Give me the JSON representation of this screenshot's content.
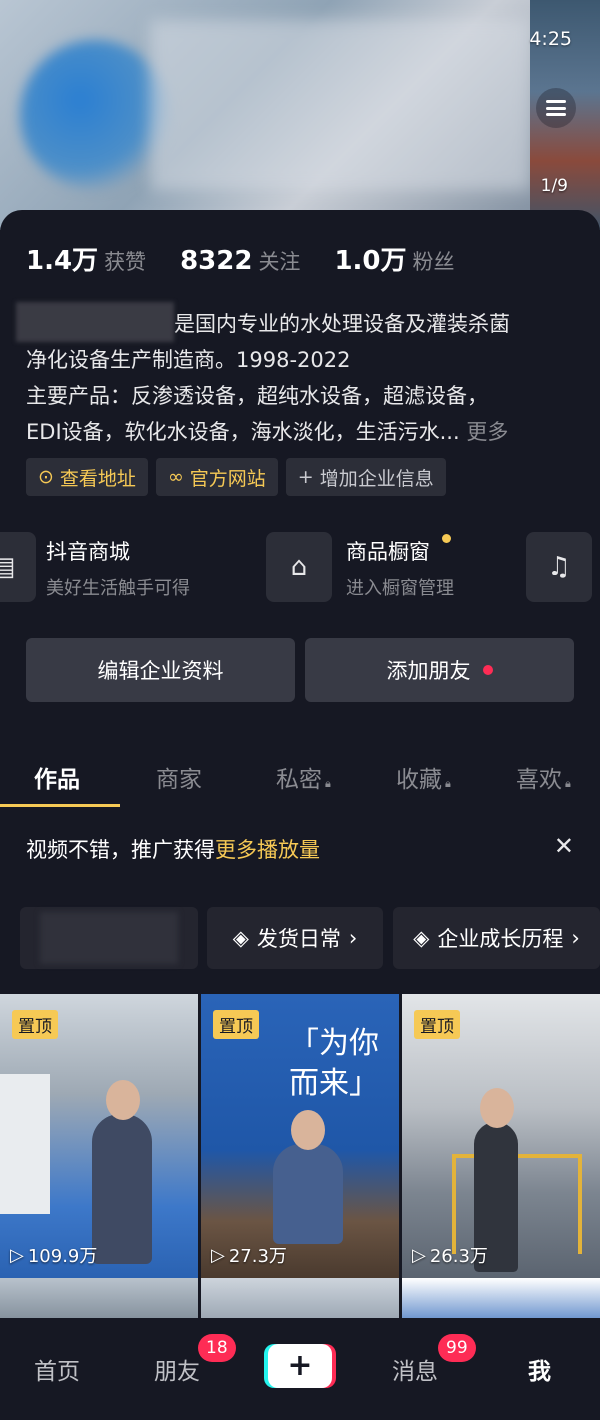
{
  "status": {
    "time": "4:25",
    "pager": "1/9"
  },
  "stats": [
    {
      "num": "1.4万",
      "label": "获赞"
    },
    {
      "num": "8322",
      "label": "关注"
    },
    {
      "num": "1.0万",
      "label": "粉丝"
    }
  ],
  "bio": {
    "line1": "是国内专业的水处理设备及灌装杀菌",
    "line2": "净化设备生产制造商。1998-2022",
    "line3": "主要产品：反渗透设备，超纯水设备，超滤设备，",
    "line4": "EDI设备，软化水设备，海水淡化，生活污水...",
    "more": "更多"
  },
  "chips": {
    "address": "查看地址",
    "website": "官方网站",
    "add_info": "增加企业信息"
  },
  "shops": {
    "mall_title": "抖音商城",
    "mall_sub": "美好生活触手可得",
    "window_title": "商品橱窗",
    "window_sub": "进入橱窗管理"
  },
  "actions": {
    "edit": "编辑企业资料",
    "add_friend": "添加朋友"
  },
  "tabs": [
    "作品",
    "商家",
    "私密",
    "收藏",
    "喜欢"
  ],
  "promo": {
    "prefix": "视频不错，推广获得",
    "highlight": "更多播放量"
  },
  "collections": {
    "shipping": "发货日常",
    "growth": "企业成长历程"
  },
  "videos": [
    {
      "pinned": "置顶",
      "plays": "109.9万"
    },
    {
      "pinned": "置顶",
      "plays": "27.3万",
      "caption_1": "「为你",
      "caption_2": "而来」"
    },
    {
      "pinned": "置顶",
      "plays": "26.3万"
    }
  ],
  "nav": {
    "home": "首页",
    "friends": "朋友",
    "friends_badge": "18",
    "messages": "消息",
    "messages_badge": "99",
    "me": "我"
  },
  "colors": {
    "background": "#161823",
    "accent": "#f6c955",
    "badge": "#fe2c55"
  }
}
